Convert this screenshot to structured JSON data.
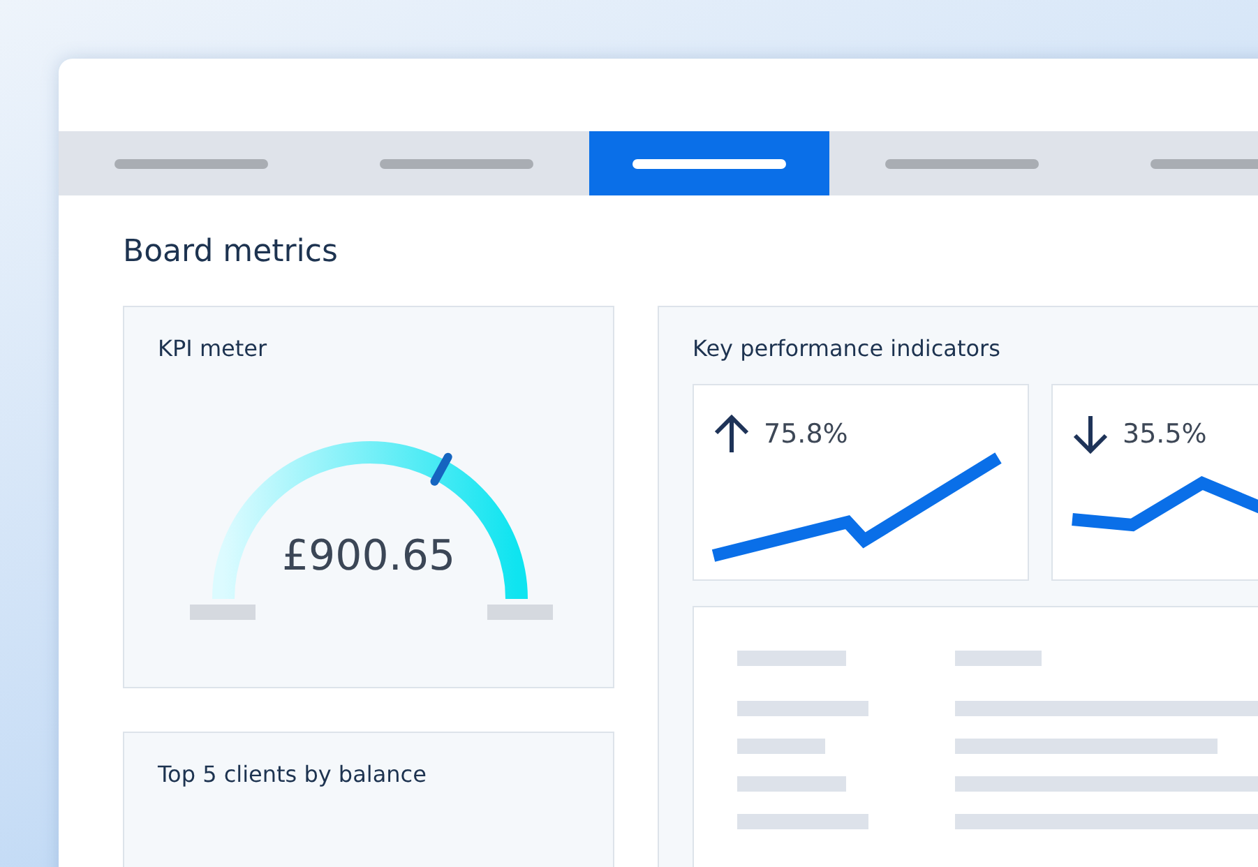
{
  "tabs": [
    {
      "selected": false
    },
    {
      "selected": false
    },
    {
      "selected": true
    },
    {
      "selected": false
    },
    {
      "selected": false
    }
  ],
  "page_title": "Board metrics",
  "kpi_meter": {
    "title": "KPI meter",
    "value": "£900.65",
    "level": 0.66
  },
  "kpis": {
    "title": "Key performance indicators",
    "cards": [
      {
        "kind": "up",
        "value": "75.8%"
      },
      {
        "kind": "down",
        "value": "35.5%"
      }
    ]
  },
  "clients_card": {
    "title": "Top 5 clients by balance"
  }
}
